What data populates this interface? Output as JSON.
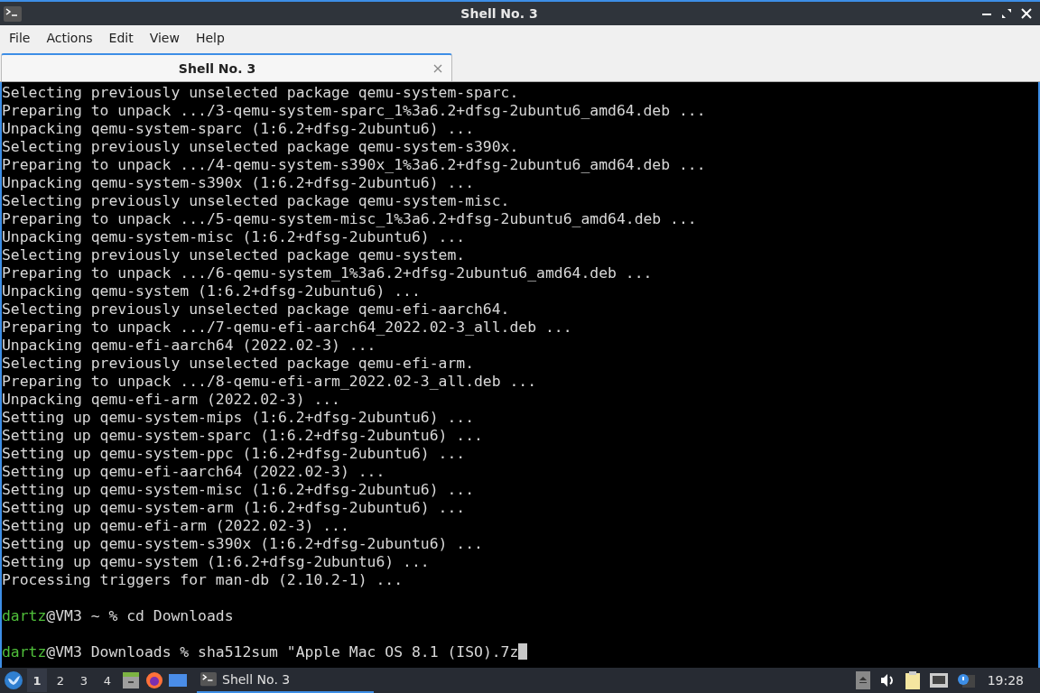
{
  "window": {
    "title": "Shell No. 3"
  },
  "menu": [
    "File",
    "Actions",
    "Edit",
    "View",
    "Help"
  ],
  "tabs": [
    {
      "label": "Shell No. 3",
      "selected": true
    }
  ],
  "terminal": {
    "lines": [
      {
        "kind": "output",
        "text": "Selecting previously unselected package qemu-system-sparc."
      },
      {
        "kind": "output",
        "text": "Preparing to unpack .../3-qemu-system-sparc_1%3a6.2+dfsg-2ubuntu6_amd64.deb ..."
      },
      {
        "kind": "output",
        "text": "Unpacking qemu-system-sparc (1:6.2+dfsg-2ubuntu6) ..."
      },
      {
        "kind": "output",
        "text": "Selecting previously unselected package qemu-system-s390x."
      },
      {
        "kind": "output",
        "text": "Preparing to unpack .../4-qemu-system-s390x_1%3a6.2+dfsg-2ubuntu6_amd64.deb ..."
      },
      {
        "kind": "output",
        "text": "Unpacking qemu-system-s390x (1:6.2+dfsg-2ubuntu6) ..."
      },
      {
        "kind": "output",
        "text": "Selecting previously unselected package qemu-system-misc."
      },
      {
        "kind": "output",
        "text": "Preparing to unpack .../5-qemu-system-misc_1%3a6.2+dfsg-2ubuntu6_amd64.deb ..."
      },
      {
        "kind": "output",
        "text": "Unpacking qemu-system-misc (1:6.2+dfsg-2ubuntu6) ..."
      },
      {
        "kind": "output",
        "text": "Selecting previously unselected package qemu-system."
      },
      {
        "kind": "output",
        "text": "Preparing to unpack .../6-qemu-system_1%3a6.2+dfsg-2ubuntu6_amd64.deb ..."
      },
      {
        "kind": "output",
        "text": "Unpacking qemu-system (1:6.2+dfsg-2ubuntu6) ..."
      },
      {
        "kind": "output",
        "text": "Selecting previously unselected package qemu-efi-aarch64."
      },
      {
        "kind": "output",
        "text": "Preparing to unpack .../7-qemu-efi-aarch64_2022.02-3_all.deb ..."
      },
      {
        "kind": "output",
        "text": "Unpacking qemu-efi-aarch64 (2022.02-3) ..."
      },
      {
        "kind": "output",
        "text": "Selecting previously unselected package qemu-efi-arm."
      },
      {
        "kind": "output",
        "text": "Preparing to unpack .../8-qemu-efi-arm_2022.02-3_all.deb ..."
      },
      {
        "kind": "output",
        "text": "Unpacking qemu-efi-arm (2022.02-3) ..."
      },
      {
        "kind": "output",
        "text": "Setting up qemu-system-mips (1:6.2+dfsg-2ubuntu6) ..."
      },
      {
        "kind": "output",
        "text": "Setting up qemu-system-sparc (1:6.2+dfsg-2ubuntu6) ..."
      },
      {
        "kind": "output",
        "text": "Setting up qemu-system-ppc (1:6.2+dfsg-2ubuntu6) ..."
      },
      {
        "kind": "output",
        "text": "Setting up qemu-efi-aarch64 (2022.02-3) ..."
      },
      {
        "kind": "output",
        "text": "Setting up qemu-system-misc (1:6.2+dfsg-2ubuntu6) ..."
      },
      {
        "kind": "output",
        "text": "Setting up qemu-system-arm (1:6.2+dfsg-2ubuntu6) ..."
      },
      {
        "kind": "output",
        "text": "Setting up qemu-efi-arm (2022.02-3) ..."
      },
      {
        "kind": "output",
        "text": "Setting up qemu-system-s390x (1:6.2+dfsg-2ubuntu6) ..."
      },
      {
        "kind": "output",
        "text": "Setting up qemu-system (1:6.2+dfsg-2ubuntu6) ..."
      },
      {
        "kind": "output",
        "text": "Processing triggers for man-db (2.10.2-1) ..."
      },
      {
        "kind": "blank"
      },
      {
        "kind": "prompt",
        "user": "dartz",
        "text": "@VM3 ~ % cd Downloads",
        "cursor": false
      },
      {
        "kind": "blank"
      },
      {
        "kind": "prompt",
        "user": "dartz",
        "text": "@VM3 Downloads % sha512sum \"Apple Mac OS 8.1 (ISO).7z",
        "cursor": true
      }
    ]
  },
  "taskbar": {
    "desktops": [
      {
        "label": "1",
        "selected": true
      },
      {
        "label": "2",
        "selected": false
      },
      {
        "label": "3",
        "selected": false
      },
      {
        "label": "4",
        "selected": false
      }
    ],
    "tasks": [
      {
        "label": "Shell No. 3",
        "selected": true
      }
    ],
    "clock": "19:28"
  }
}
